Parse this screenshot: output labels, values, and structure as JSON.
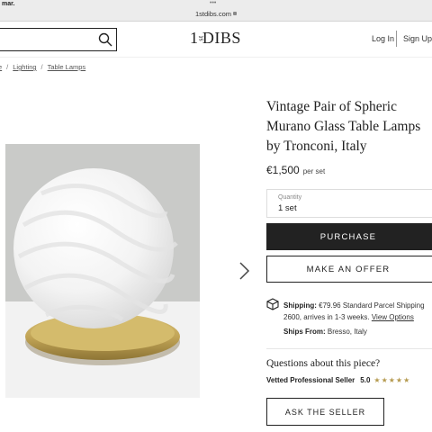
{
  "browser": {
    "status_left": "mar.",
    "dots": "•••",
    "url": "1stdibs.com"
  },
  "header": {
    "logo_pre": "1",
    "logo_mid": "st",
    "logo_post": "DIBS",
    "login_label": "Log In",
    "signup_label": "Sign Up"
  },
  "breadcrumb": {
    "items": [
      "e",
      "Lighting",
      "Table Lamps"
    ]
  },
  "product": {
    "title_lines": [
      "Vintage Pair of Spheric",
      "Murano Glass Table Lamps",
      "by Tronconi, Italy"
    ],
    "price": "€1,500",
    "price_unit": "per set",
    "quantity_label": "Quantity",
    "quantity_value": "1 set",
    "purchase_label": "PURCHASE",
    "offer_label": "MAKE AN OFFER"
  },
  "shipping": {
    "label": "Shipping:",
    "line1": "€79.96 Standard Parcel Shipping",
    "line2": "2600, arrives in 1-3 weeks.",
    "view_options": "View Options",
    "ships_from_label": "Ships From:",
    "ships_from_value": "Bresso, Italy"
  },
  "seller": {
    "question": "Questions about this piece?",
    "vetted_label": "Vetted Professional Seller",
    "rating": "5.0",
    "stars": "★★★★★",
    "ask_label": "ASK THE SELLER"
  },
  "icons": {
    "search": "search-icon",
    "next": "chevron-right-icon",
    "shipping": "box-icon"
  },
  "colors": {
    "primary": "#222222",
    "star": "#b59a4f"
  }
}
